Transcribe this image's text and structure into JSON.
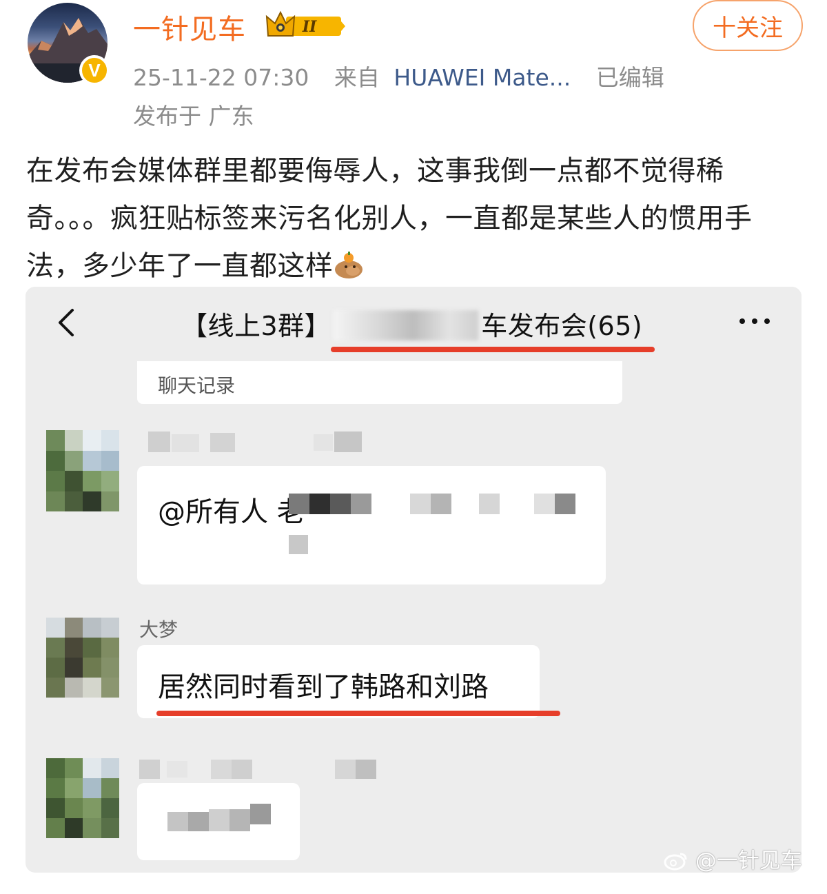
{
  "post": {
    "username": "一针见车",
    "level_badge": "II",
    "verified_badge": "V",
    "timestamp": "25-11-22 07:30",
    "source_prefix": "来自",
    "device": "HUAWEI Mate...",
    "edited": "已编辑",
    "location": "发布于 广东",
    "follow_label": "十关注",
    "text": "在发布会媒体群里都要侮辱人，这事我倒一点都不觉得稀奇。。。疯狂贴标签来污名化别人，一直都是某些人的惯用手法，多少年了一直都这样",
    "emoji_icon": "capybara-emoji-icon"
  },
  "screenshot": {
    "chat_title_prefix": "【线上3群】",
    "chat_title_suffix": "车发布会(65)",
    "history_label": "聊天记录",
    "messages": [
      {
        "sender": "",
        "text_visible": "@所有人 老",
        "redacted": true
      },
      {
        "sender": "大梦",
        "text": "居然同时看到了韩路和刘路",
        "redacted": false
      },
      {
        "sender": "",
        "text_visible": "",
        "redacted": true
      }
    ],
    "underline_color": "#e63e2a"
  },
  "watermark": {
    "text": "@一针见车",
    "icon": "weibo-icon"
  },
  "colors": {
    "username": "#f36c21",
    "link": "#3d5a8a",
    "meta": "#8c8c8c",
    "chat_bg": "#ededed"
  }
}
